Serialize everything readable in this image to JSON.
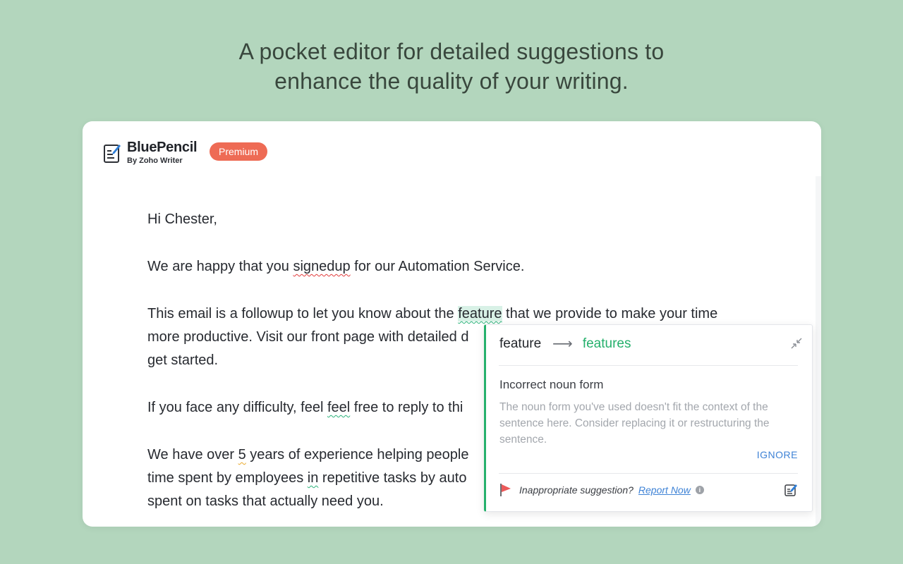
{
  "headline": {
    "line1": "A pocket editor for detailed suggestions to",
    "line2": "enhance the quality of your writing."
  },
  "brand": {
    "name": "BluePencil",
    "subtitle": "By Zoho Writer",
    "badge": "Premium"
  },
  "document": {
    "greeting": "Hi Chester,",
    "p1": {
      "a": "We are happy that you ",
      "err": "signedup",
      "b": " for our Automation Service."
    },
    "p2": {
      "a": "This email is a followup to let you know about the ",
      "err": "feature",
      "b": " that we provide to make your time",
      "line2": "more productive. Visit our front page with detailed d",
      "line3": "get started."
    },
    "p3": {
      "a": "If you face any difficulty, feel ",
      "err": "feel",
      "b": " free to reply to thi"
    },
    "p4": {
      "a": "We have over ",
      "err1": "5",
      "b": " years of experience helping people",
      "line2a": "time spent by employees ",
      "err2": "in",
      "line2b": " repetitive tasks by auto",
      "line3": "spent on tasks that actually need you."
    }
  },
  "suggestion": {
    "original": "feature",
    "arrow": "⟶",
    "replacement": "features",
    "error_title": "Incorrect noun form",
    "error_description": "The noun form you've used doesn't fit the context of the sentence here. Consider replacing it or restructuring the sentence.",
    "ignore_label": "IGNORE",
    "inappropriate_label": "Inappropriate suggestion?",
    "report_label": "Report Now",
    "info_glyph": "i"
  },
  "colors": {
    "background": "#b3d6bd",
    "accent_green": "#25b06c",
    "premium": "#ee6b55",
    "link_blue": "#3f83d6",
    "error_red": "#e23b3b",
    "error_yellow": "#e9a82a"
  }
}
